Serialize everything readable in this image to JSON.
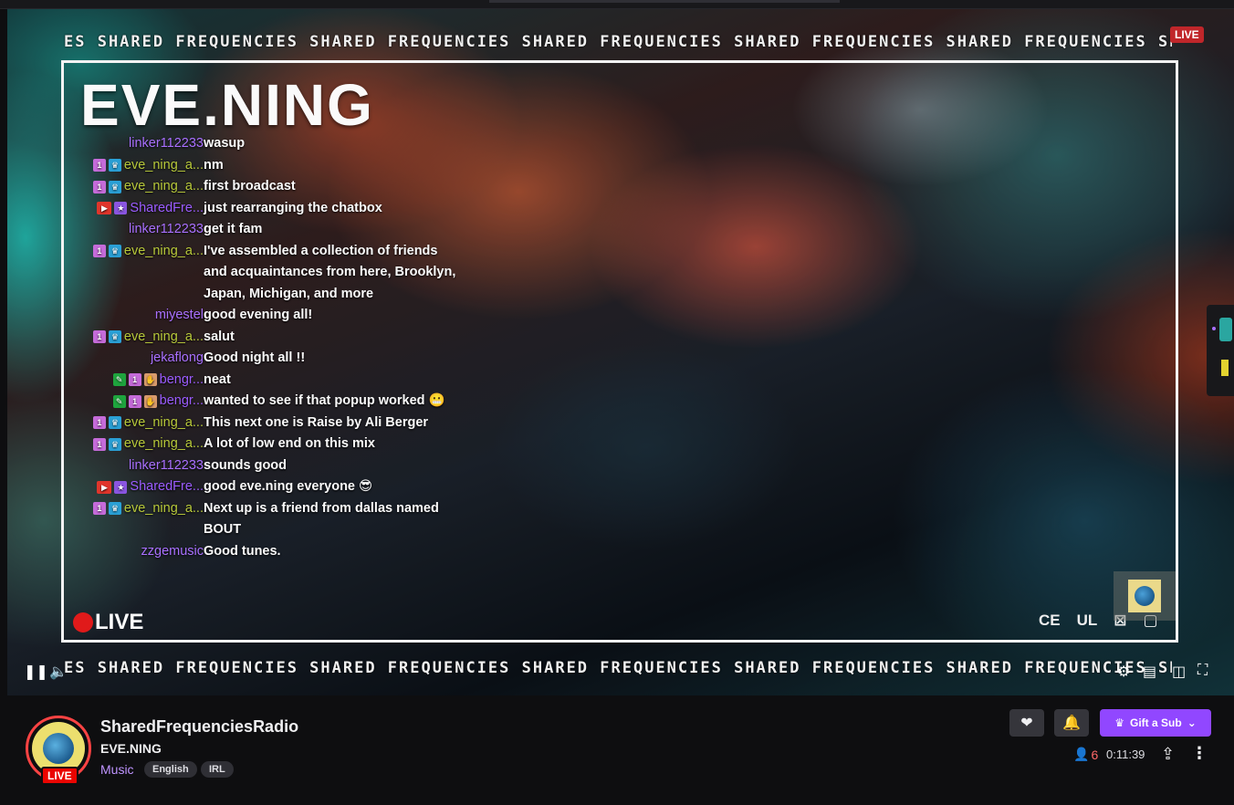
{
  "ticker_text": "ES SHARED FREQUENCIES SHARED FREQUENCIES SHARED FREQUENCIES SHARED FREQUENCIES SHARED FREQUENCIES SHARED FREQUENCIES SHARED FREQUENCIES SHARED FREQUENCIES",
  "player": {
    "live_badge": "LIVE",
    "overlay_title": "EVE.NING",
    "overlay_live": "LIVE",
    "marks": [
      "CE",
      "UL",
      "⊠",
      "▢"
    ]
  },
  "chat": [
    {
      "user": "linker112233",
      "color": "#a970ff",
      "badges": [],
      "text": "wasup"
    },
    {
      "user": "eve_ning_a...",
      "color": "#b7c83a",
      "badges": [
        "sub",
        "crown"
      ],
      "text": "nm"
    },
    {
      "user": "eve_ning_a...",
      "color": "#b7c83a",
      "badges": [
        "sub",
        "crown"
      ],
      "text": "first broadcast"
    },
    {
      "user": "SharedFre...",
      "color": "#9b5cff",
      "badges": [
        "vid",
        "star"
      ],
      "text": "just rearranging the chatbox"
    },
    {
      "user": "linker112233",
      "color": "#a970ff",
      "badges": [],
      "text": "get it fam"
    },
    {
      "user": "eve_ning_a...",
      "color": "#b7c83a",
      "badges": [
        "sub",
        "crown"
      ],
      "text": "I've assembled a collection of friends and acquaintances from here, Brooklyn, Japan, Michigan, and more"
    },
    {
      "user": "miyestel",
      "color": "#a970ff",
      "badges": [],
      "text": "good evening all!"
    },
    {
      "user": "eve_ning_a...",
      "color": "#b7c83a",
      "badges": [
        "sub",
        "crown"
      ],
      "text": "salut"
    },
    {
      "user": "jekaflong",
      "color": "#a970ff",
      "badges": [],
      "text": "Good night all !!"
    },
    {
      "user": "bengr...",
      "color": "#9b5cff",
      "badges": [
        "mod",
        "sub",
        "hand"
      ],
      "text": "neat"
    },
    {
      "user": "bengr...",
      "color": "#9b5cff",
      "badges": [
        "mod",
        "sub",
        "hand"
      ],
      "text": "wanted to see if that popup worked 😬"
    },
    {
      "user": "eve_ning_a...",
      "color": "#b7c83a",
      "badges": [
        "sub",
        "crown"
      ],
      "text": "This next one is Raise by Ali Berger"
    },
    {
      "user": "eve_ning_a...",
      "color": "#b7c83a",
      "badges": [
        "sub",
        "crown"
      ],
      "text": "A lot of low end on this mix"
    },
    {
      "user": "linker112233",
      "color": "#a970ff",
      "badges": [],
      "text": "sounds good"
    },
    {
      "user": "SharedFre...",
      "color": "#9b5cff",
      "badges": [
        "vid",
        "star"
      ],
      "text": "good eve.ning everyone 😎"
    },
    {
      "user": "eve_ning_a...",
      "color": "#b7c83a",
      "badges": [
        "sub",
        "crown"
      ],
      "text": "Next up is a friend from dallas named BOUT"
    },
    {
      "user": "zzgemusic",
      "color": "#a970ff",
      "badges": [],
      "text": "Good tunes."
    }
  ],
  "channel": {
    "name": "SharedFrequenciesRadio",
    "title": "EVE.NING",
    "category": "Music",
    "tags": [
      "English",
      "IRL"
    ],
    "live_label": "LIVE",
    "viewers": "6",
    "uptime": "0:11:39",
    "gift_label": "Gift a Sub"
  },
  "icons": [
    "pause-icon",
    "mute-icon",
    "settings-icon",
    "theatre-mode-icon",
    "fullscreen-icon",
    "heart-icon",
    "bell-icon",
    "crown-icon",
    "chevron-down-icon",
    "person-icon",
    "share-icon",
    "more-icon"
  ],
  "colors": {
    "accent": "#9147ff",
    "live": "#eb0400"
  }
}
